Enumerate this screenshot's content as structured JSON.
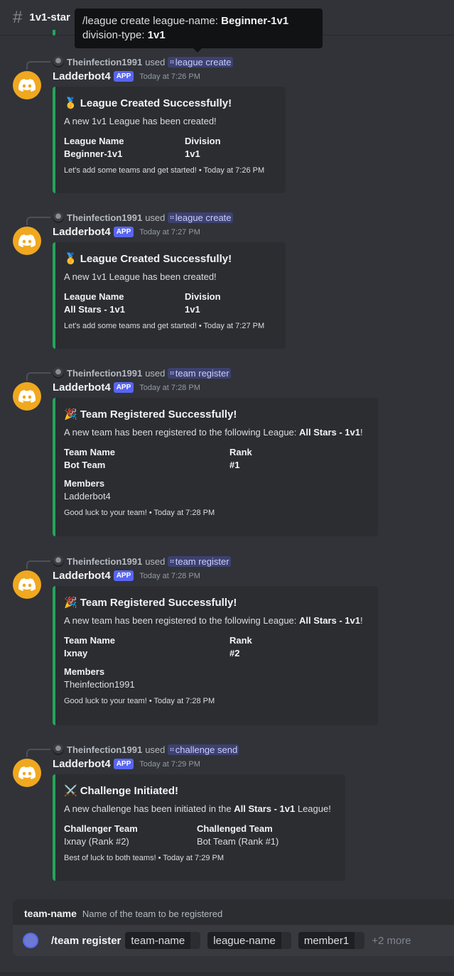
{
  "header": {
    "channel": "1v1-star"
  },
  "tooltip": {
    "line1_prefix": "/league create league-name:",
    "line1_value": "Beginner-1v1",
    "line2_prefix": "division-type:",
    "line2_value": "1v1"
  },
  "messages": [
    {
      "reply_user": "Theinfection1991",
      "reply_used": "used",
      "reply_command": "league create",
      "author": "Ladderbot4",
      "badge": "APP",
      "time": "Today at 7:26 PM",
      "embed": {
        "emoji": "🥇",
        "title": "League Created Successfully!",
        "desc": "A new 1v1 League has been created!",
        "f1_name": "League Name",
        "f1_value": "Beginner-1v1",
        "f2_name": "Division",
        "f2_value": "1v1",
        "footer": "Let's add some teams and get started! • Today at 7:26 PM"
      }
    },
    {
      "reply_user": "Theinfection1991",
      "reply_used": "used",
      "reply_command": "league create",
      "author": "Ladderbot4",
      "badge": "APP",
      "time": "Today at 7:27 PM",
      "embed": {
        "emoji": "🥇",
        "title": "League Created Successfully!",
        "desc": "A new 1v1 League has been created!",
        "f1_name": "League Name",
        "f1_value": "All Stars - 1v1",
        "f2_name": "Division",
        "f2_value": "1v1",
        "footer": "Let's add some teams and get started! • Today at 7:27 PM"
      }
    },
    {
      "reply_user": "Theinfection1991",
      "reply_used": "used",
      "reply_command": "team register",
      "author": "Ladderbot4",
      "badge": "APP",
      "time": "Today at 7:28 PM",
      "embed": {
        "emoji": "🎉",
        "title": "Team Registered Successfully!",
        "desc_prefix": "A new team has been registered to the following League: ",
        "desc_bold": "All Stars - 1v1",
        "desc_suffix": "!",
        "f1_name": "Team Name",
        "f1_value": "Bot Team",
        "f2_name": "Rank",
        "f2_value": "#1",
        "f3_name": "Members",
        "f3_value": "Ladderbot4",
        "footer": "Good luck to your team! • Today at 7:28 PM"
      }
    },
    {
      "reply_user": "Theinfection1991",
      "reply_used": "used",
      "reply_command": "team register",
      "author": "Ladderbot4",
      "badge": "APP",
      "time": "Today at 7:28 PM",
      "embed": {
        "emoji": "🎉",
        "title": "Team Registered Successfully!",
        "desc_prefix": "A new team has been registered to the following League: ",
        "desc_bold": "All Stars - 1v1",
        "desc_suffix": "!",
        "f1_name": "Team Name",
        "f1_value": "Ixnay",
        "f2_name": "Rank",
        "f2_value": "#2",
        "f3_name": "Members",
        "f3_value": "Theinfection1991",
        "footer": "Good luck to your team! • Today at 7:28 PM"
      }
    },
    {
      "reply_user": "Theinfection1991",
      "reply_used": "used",
      "reply_command": "challenge send",
      "author": "Ladderbot4",
      "badge": "APP",
      "time": "Today at 7:29 PM",
      "embed": {
        "emoji": "⚔️",
        "title": "Challenge Initiated!",
        "desc_prefix": "A new challenge has been initiated in the ",
        "desc_bold": "All Stars - 1v1",
        "desc_suffix": " League!",
        "f1_name": "Challenger Team",
        "f1_value": "Ixnay (Rank #2)",
        "f2_name": "Challenged Team",
        "f2_value": "Bot Team (Rank #1)",
        "footer": "Best of luck to both teams! • Today at 7:29 PM"
      }
    }
  ],
  "option_tip": {
    "name": "team-name",
    "desc": "Name of the team to be registered"
  },
  "composer": {
    "command": "/team register",
    "options": [
      "team-name",
      "league-name",
      "member1"
    ],
    "more": "+2 more"
  },
  "colors": {
    "accent": "#5865f2",
    "embed_bar": "#23a55a",
    "bot_avatar": "#f0a81f"
  }
}
